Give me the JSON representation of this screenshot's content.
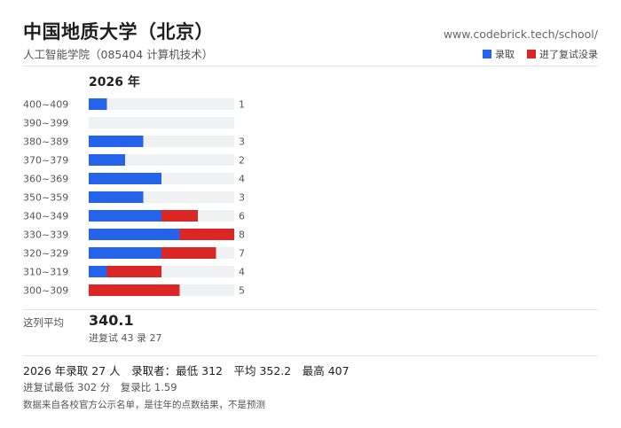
{
  "header": {
    "title": "中国地质大学（北京）",
    "subtitle": "人工智能学院（085404 计算机技术）",
    "site": "www.codebrick.tech/school/"
  },
  "legend": {
    "admitted_label": "录取",
    "rejected_label": "进了复试没录"
  },
  "colors": {
    "admitted": "#2563eb",
    "rejected": "#dc2626",
    "track": "#f0f1f3"
  },
  "chart_data": {
    "type": "bar",
    "orientation": "horizontal",
    "stacked": true,
    "title": "2026 年",
    "categories": [
      "400~409",
      "390~399",
      "380~389",
      "370~379",
      "360~369",
      "350~359",
      "340~349",
      "330~339",
      "320~329",
      "310~319",
      "300~309"
    ],
    "series": [
      {
        "name": "录取",
        "values": [
          1,
          0,
          3,
          2,
          4,
          3,
          4,
          5,
          4,
          1,
          0
        ]
      },
      {
        "name": "进了复试没录",
        "values": [
          0,
          0,
          0,
          0,
          0,
          0,
          2,
          3,
          3,
          3,
          5
        ]
      }
    ],
    "totals": [
      1,
      0,
      3,
      2,
      4,
      3,
      6,
      8,
      7,
      4,
      5
    ],
    "xlim": [
      0,
      8
    ]
  },
  "average": {
    "label": "这列平均",
    "value": "340.1",
    "sub": "进复试 43 录 27"
  },
  "summary": {
    "line1": "2026 年录取 27 人　录取者：最低 312　平均 352.2　最高 407",
    "line2": "进复试最低 302 分　复录比 1.59",
    "note": "数据来自各校官方公示名单，是往年的点数结果，不是预测"
  }
}
